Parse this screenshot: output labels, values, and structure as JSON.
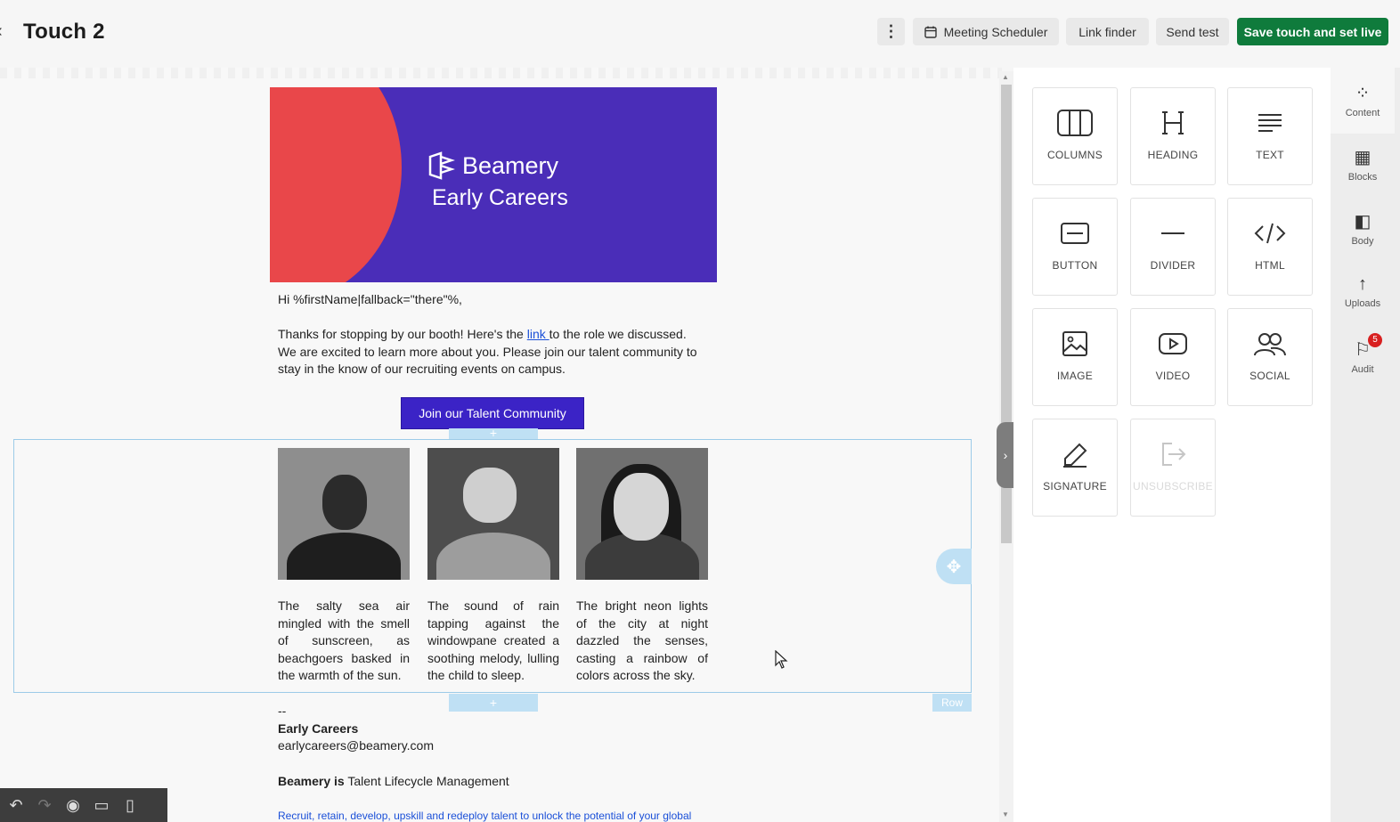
{
  "header": {
    "back_icon": "chevron-left-icon",
    "title": "Touch 2",
    "more_icon": "kebab-icon",
    "meeting_scheduler_label": "Meeting Scheduler",
    "link_finder_label": "Link finder",
    "send_test_label": "Send test",
    "save_label": "Save touch and set live"
  },
  "email": {
    "hero_brand": "Beamery",
    "hero_subtitle": "Early Careers",
    "greeting": "Hi %firstName|fallback=\"there\"%,",
    "para_before_link": "Thanks for stopping by our booth! Here's the ",
    "link_text": "link ",
    "para_after_link": "to the role we discussed.",
    "para_line2": "We are excited to learn more about you. Please join our talent community to",
    "para_line3": "stay in the know of our recruiting events on campus.",
    "cta_label": "Join our Talent Community",
    "captions": [
      "The salty sea air mingled with the smell of sunscreen, as beachgoers basked in the warmth of the sun.",
      "The sound of rain tapping against the windowpane created a soothing melody, lulling the child to sleep.",
      "The bright neon lights of the city at night dazzled the senses, casting a rainbow of colors across the sky."
    ],
    "signature_dash": "--",
    "signature_team": "Early Careers",
    "signature_email": "earlycareers@beamery.com",
    "tagline_bold": "Beamery is",
    "tagline_rest": " Talent Lifecycle Management",
    "footer_cut": "Recruit, retain, develop, upskill and redeploy talent to unlock the potential of your global"
  },
  "editor": {
    "row_tag": "Row",
    "add_symbol": "+"
  },
  "blocks": [
    {
      "label": "COLUMNS",
      "icon": "columns-icon"
    },
    {
      "label": "HEADING",
      "icon": "heading-icon"
    },
    {
      "label": "TEXT",
      "icon": "text-icon"
    },
    {
      "label": "BUTTON",
      "icon": "button-icon"
    },
    {
      "label": "DIVIDER",
      "icon": "divider-icon"
    },
    {
      "label": "HTML",
      "icon": "code-icon"
    },
    {
      "label": "IMAGE",
      "icon": "image-icon"
    },
    {
      "label": "VIDEO",
      "icon": "video-icon"
    },
    {
      "label": "SOCIAL",
      "icon": "social-icon"
    },
    {
      "label": "SIGNATURE",
      "icon": "signature-icon"
    },
    {
      "label": "UNSUBSCRIBE",
      "icon": "unsubscribe-icon"
    }
  ],
  "nav": {
    "content": "Content",
    "blocks": "Blocks",
    "body": "Body",
    "uploads": "Uploads",
    "audit": "Audit",
    "audit_badge": "5"
  },
  "colors": {
    "save_button": "#0f7b3c",
    "hero_bg": "#4a2db8",
    "hero_circle": "#e9474a",
    "cta_bg": "#3b23c6",
    "selection": "#9ccbe8"
  }
}
